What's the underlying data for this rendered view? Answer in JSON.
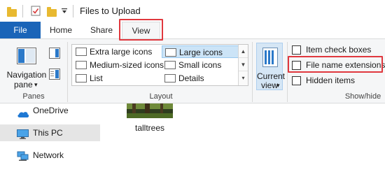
{
  "titlebar": {
    "title": "Files to Upload"
  },
  "tabs": {
    "file": "File",
    "home": "Home",
    "share": "Share",
    "view": "View"
  },
  "panes": {
    "nav_pane_line1": "Navigation",
    "nav_pane_line2": "pane",
    "nav_pane_arrow": "▾",
    "group_label": "Panes"
  },
  "layout": {
    "items": [
      {
        "label": "Extra large icons",
        "selected": false
      },
      {
        "label": "Large icons",
        "selected": true
      },
      {
        "label": "Medium-sized icons",
        "selected": false
      },
      {
        "label": "Small icons",
        "selected": false
      },
      {
        "label": "List",
        "selected": false
      },
      {
        "label": "Details",
        "selected": false
      }
    ],
    "group_label": "Layout"
  },
  "current_view": {
    "line1": "Current",
    "line2": "view",
    "arrow": "▾"
  },
  "show_hide": {
    "item_check_boxes": "Item check boxes",
    "file_name_extensions": "File name extensions",
    "hidden_items": "Hidden items",
    "group_label": "Show/hide"
  },
  "nav": {
    "onedrive": "OneDrive",
    "this_pc": "This PC",
    "network": "Network"
  },
  "content": {
    "file_label": "talltrees"
  },
  "colors": {
    "file_tab": "#1a64b8",
    "highlight_box": "#e0383e",
    "selected_item": "#cce4f7"
  }
}
